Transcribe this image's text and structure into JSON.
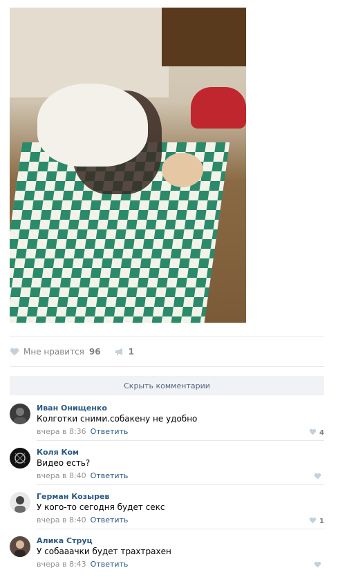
{
  "post": {
    "image_alt": "photo",
    "likes_label": "Мне нравится",
    "likes_count": "96",
    "shares_count": "1"
  },
  "comments_toggle": "Скрыть комментарии",
  "comments": [
    {
      "author": "Иван Онищенко",
      "text": "Колготки сними.собакену не удобно",
      "time": "вчера в 8:36",
      "reply": "Ответить",
      "likes": "4"
    },
    {
      "author": "Коля Ком",
      "text": "Видео есть?",
      "time": "вчера в 8:40",
      "reply": "Ответить",
      "likes": ""
    },
    {
      "author": "Герман Козырев",
      "text": "У кого-то сегодня будет секс",
      "time": "вчера в 8:40",
      "reply": "Ответить",
      "likes": "1"
    },
    {
      "author": "Алика Струц",
      "text": "У собааачки будет трахтрахен",
      "time": "вчера в 8:43",
      "reply": "Ответить",
      "likes": ""
    }
  ],
  "icons": {
    "like": "heart-icon",
    "share": "megaphone-icon"
  },
  "colors": {
    "link": "#2a5885",
    "meta": "#939393",
    "divider": "#e7e8ec",
    "button_bg": "#f0f2f5"
  }
}
